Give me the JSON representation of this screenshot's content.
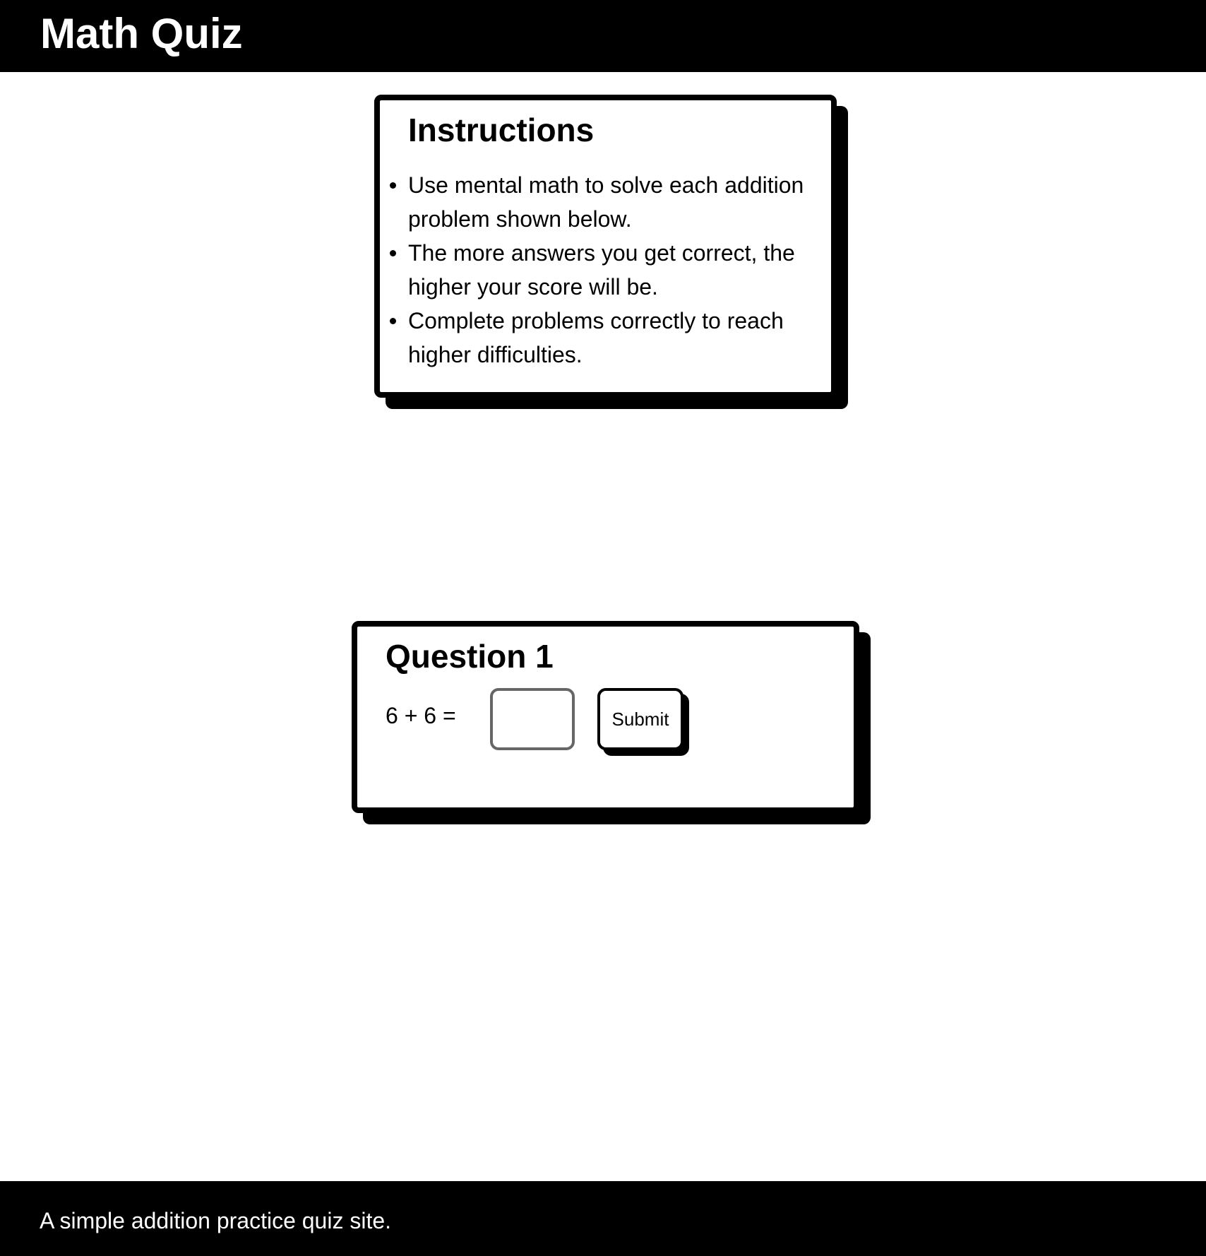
{
  "header": {
    "title": "Math Quiz"
  },
  "instructions": {
    "title": "Instructions",
    "items": [
      "Use mental math to solve each addition problem shown below.",
      "The more answers you get correct, the higher your score will be.",
      "Complete problems correctly to reach higher difficulties."
    ]
  },
  "question": {
    "title": "Question 1",
    "problem": "6 + 6 =",
    "answer_value": "",
    "submit_label": "Submit"
  },
  "footer": {
    "text": "A simple addition practice quiz site."
  }
}
